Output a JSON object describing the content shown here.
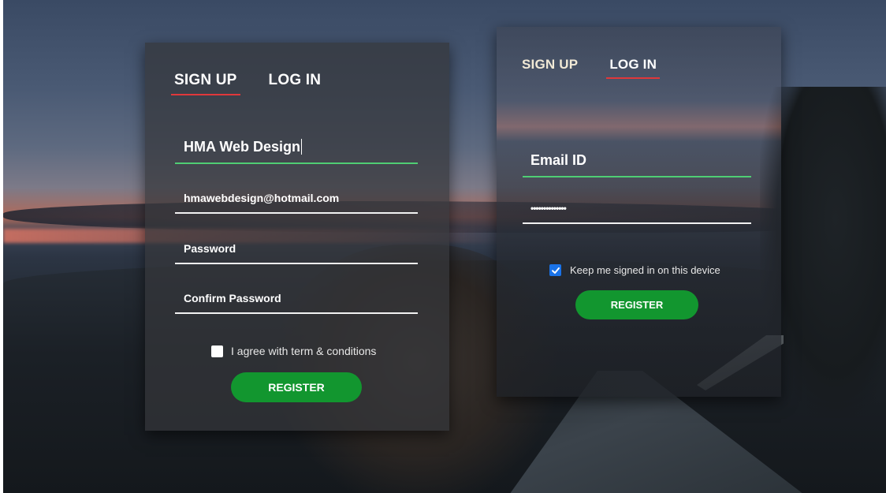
{
  "background": {
    "description_colors": {
      "sky_top": "#3a4a64",
      "sunset": "#b06a5a",
      "ground": "#161a1e"
    }
  },
  "theme": {
    "accent_active_tab": "#e0383b",
    "focused_underline": "#4fce74",
    "button": "#12962f",
    "checkbox_checked": "#1a73e8"
  },
  "signup_card": {
    "tabs": [
      {
        "label": "SIGN UP",
        "active": true
      },
      {
        "label": "LOG IN",
        "active": false
      }
    ],
    "fields": {
      "name": {
        "value": "HMA Web Design"
      },
      "email": {
        "value": "hmawebdesign@hotmail.com"
      },
      "password": {
        "value": "Password"
      },
      "confirm": {
        "value": "Confirm Password"
      }
    },
    "agree": {
      "label": "I agree with term & conditions",
      "checked": false
    },
    "register_label": "REGISTER"
  },
  "login_card": {
    "tabs": [
      {
        "label": "SIGN UP",
        "active": false
      },
      {
        "label": "LOG IN",
        "active": true
      }
    ],
    "fields": {
      "email": {
        "value": "Email ID"
      },
      "password": {
        "value": "••••••••••••••"
      }
    },
    "keep_signed": {
      "label": "Keep me signed in on this device",
      "checked": true
    },
    "register_label": "REGISTER"
  }
}
